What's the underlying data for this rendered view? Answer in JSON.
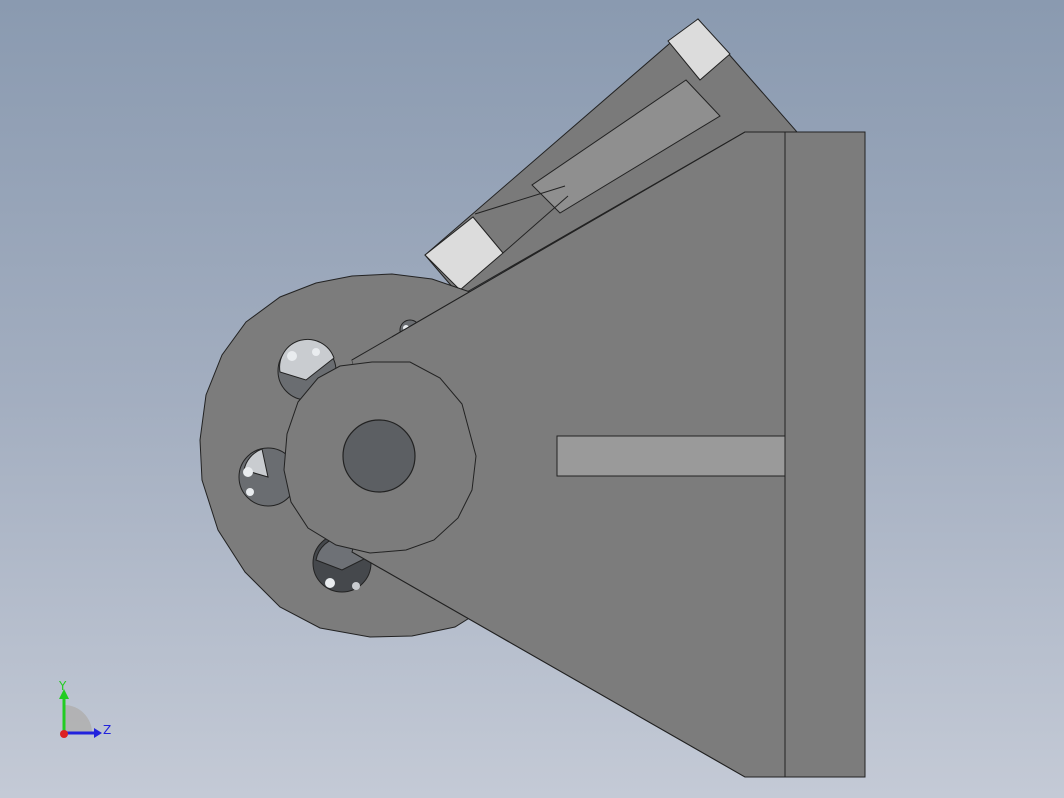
{
  "triad": {
    "y_label": "Y",
    "z_label": "Z",
    "y_color": "#22cc22",
    "z_color": "#2222dd",
    "x_color": "#dd2222"
  },
  "colors": {
    "background_top": "#8a9ab0",
    "background_bottom": "#c4cad6",
    "part_face": "#7c7c7c",
    "part_dark": "#5c5f63",
    "part_light_face": "#dcdcdc",
    "slot_face": "#9a9a9a",
    "edge": "#222222"
  }
}
